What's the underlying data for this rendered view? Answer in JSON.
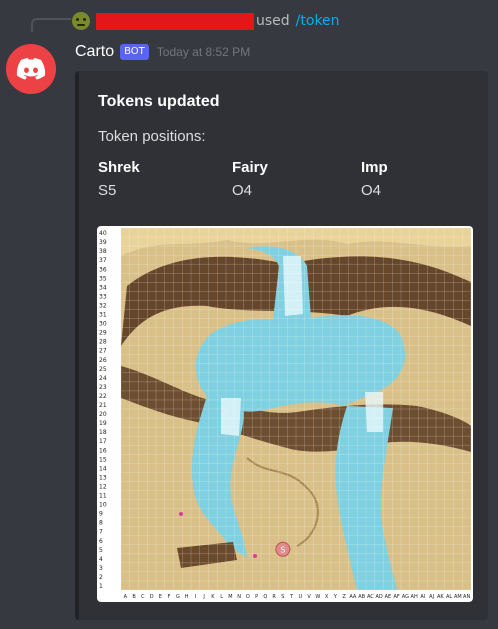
{
  "reply": {
    "used_text": "used",
    "command": "/token"
  },
  "author": {
    "name": "Carto",
    "bot_tag": "BOT",
    "timestamp": "Today at 8:52 PM"
  },
  "embed": {
    "title": "Tokens updated",
    "description": "Token positions:",
    "fields": [
      {
        "name": "Shrek",
        "value": "S5"
      },
      {
        "name": "Fairy",
        "value": "O4"
      },
      {
        "name": "Imp",
        "value": "O4"
      }
    ]
  },
  "map": {
    "columns": [
      "A",
      "B",
      "C",
      "D",
      "E",
      "F",
      "G",
      "H",
      "I",
      "J",
      "K",
      "L",
      "M",
      "N",
      "O",
      "P",
      "Q",
      "R",
      "S",
      "T",
      "U",
      "V",
      "W",
      "X",
      "Y",
      "Z",
      "AA",
      "AB",
      "AC",
      "AD",
      "AE",
      "AF",
      "AG",
      "AH",
      "AI",
      "AJ",
      "AK",
      "AL",
      "AM",
      "AN"
    ],
    "rows": 40,
    "tokens": [
      {
        "label": "S",
        "col": "S",
        "row": 5
      }
    ],
    "colors": {
      "sand": "#d9c088",
      "rock": "#5a3a22",
      "water": "#7fd0e0",
      "token": "#e08a8a"
    }
  }
}
